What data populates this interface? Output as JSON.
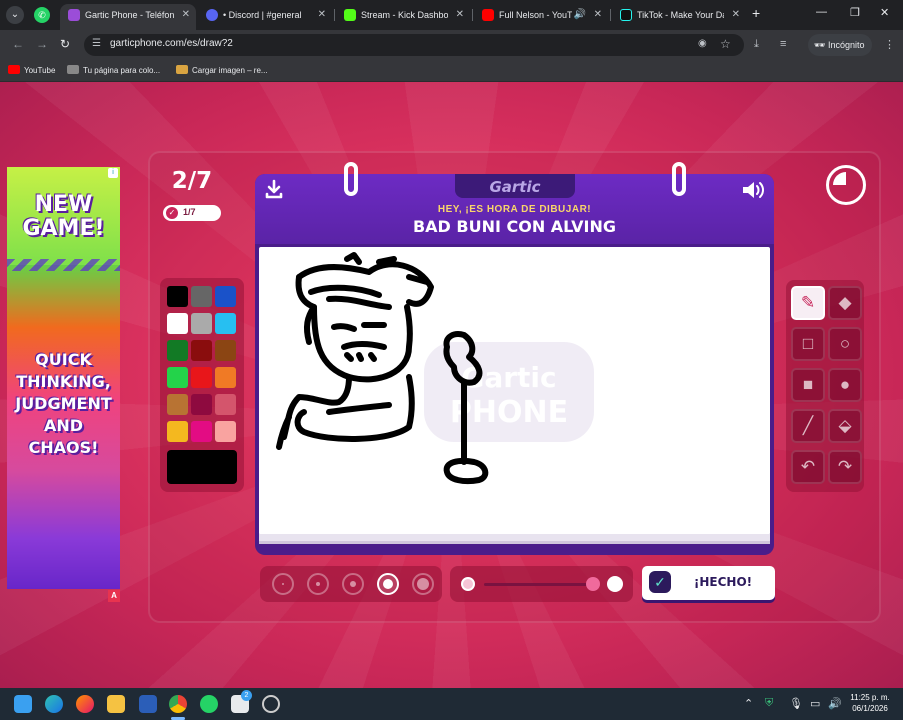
{
  "browser": {
    "tabs": [
      {
        "title": "Gartic Phone - Teléfono",
        "active": true,
        "color": "#9b4dd8"
      },
      {
        "title": "• Discord | #general",
        "active": false,
        "color": "#5865f2"
      },
      {
        "title": "Stream - Kick Dashboard",
        "active": false,
        "color": "#53fc18"
      },
      {
        "title": "Full Nelson - YouTube",
        "active": false,
        "color": "#ff0000"
      },
      {
        "title": "TikTok - Make Your Day",
        "active": false,
        "color": "#111111"
      }
    ],
    "url": "garticphone.com/es/draw?2",
    "incognito_label": "Incógnito",
    "bookmarks": [
      {
        "label": "YouTube",
        "color": "#ff0000"
      },
      {
        "label": "Tu página para colo...",
        "color": "#888888"
      },
      {
        "label": "Cargar imagen – re...",
        "color": "#d9a441"
      }
    ]
  },
  "ad": {
    "headline": "NEW\nGAME!",
    "tagline": "QUICK\nTHINKING,\nJUDGMENT\nAND\nCHAOS!",
    "choice_label": "A"
  },
  "game": {
    "round": "2/7",
    "done_count": "1/7",
    "logo": "Gartic",
    "subtitle": "HEY, ¡ES HORA DE DIBUJAR!",
    "prompt": "BAD BUNI CON ALVING",
    "done_button": "¡HECHO!",
    "timer_remaining_fraction": 0.25,
    "palette": [
      "#000000",
      "#666666",
      "#1a52c9",
      "#ffffff",
      "#aaaaaa",
      "#27bff1",
      "#127a25",
      "#8a0d0d",
      "#8b4513",
      "#23d34a",
      "#e8161a",
      "#f07a25",
      "#b87333",
      "#8e0a3f",
      "#d4556c",
      "#f4b81f",
      "#e30c83",
      "#f9a3a0"
    ],
    "current_color": "#000000",
    "tools": [
      "pencil-icon",
      "eraser-icon",
      "rect-outline-icon",
      "circle-outline-icon",
      "rect-fill-icon",
      "circle-fill-icon",
      "line-icon",
      "bucket-icon",
      "undo-icon",
      "redo-icon"
    ],
    "selected_tool": "pencil-icon",
    "brush_sizes": 5,
    "selected_brush_size": 4,
    "opacity_level": 1.0
  },
  "taskbar": {
    "time": "11:25 p. m.",
    "date": "06/1/2026",
    "badge": "2"
  }
}
